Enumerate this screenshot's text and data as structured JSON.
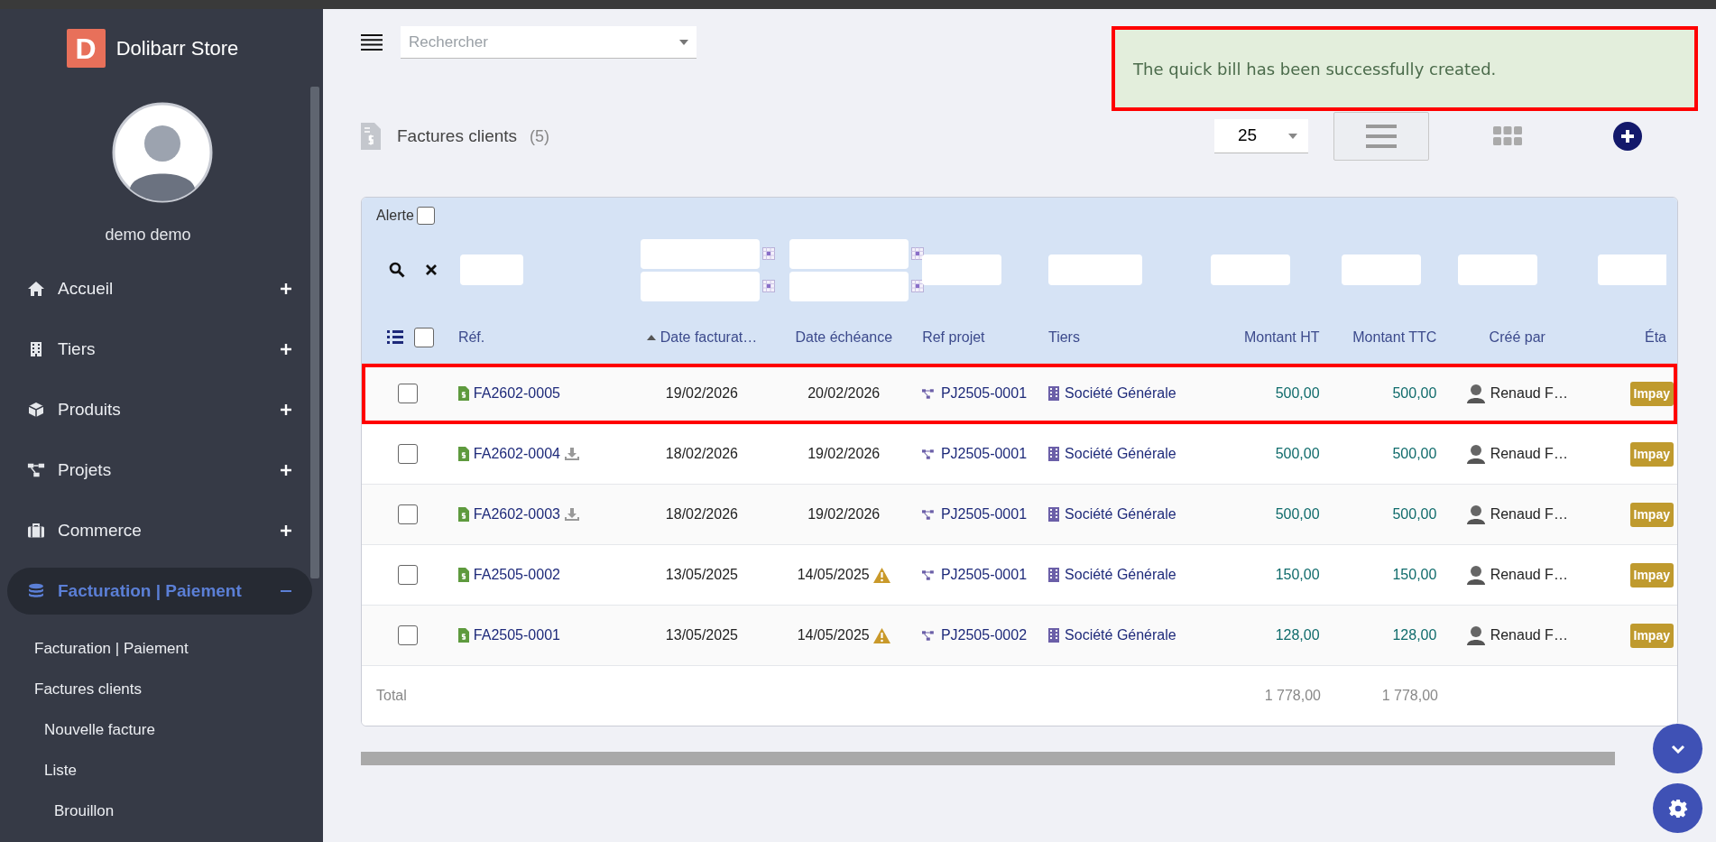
{
  "sidebar": {
    "brand": {
      "letter": "D",
      "name": "Dolibarr Store"
    },
    "user": {
      "name": "demo demo"
    },
    "menu": [
      {
        "label": "Accueil",
        "expanded": false,
        "selected": false
      },
      {
        "label": "Tiers",
        "expanded": false,
        "selected": false
      },
      {
        "label": "Produits",
        "expanded": false,
        "selected": false
      },
      {
        "label": "Projets",
        "expanded": false,
        "selected": false
      },
      {
        "label": "Commerce",
        "expanded": false,
        "selected": false
      },
      {
        "label": "Facturation | Paiement",
        "expanded": true,
        "selected": true,
        "children": [
          {
            "label": "Facturation | Paiement"
          },
          {
            "label": "Factures clients",
            "children": [
              {
                "label": "Nouvelle facture"
              },
              {
                "label": "Liste",
                "children": [
                  {
                    "label": "Brouillon"
                  }
                ]
              }
            ]
          }
        ]
      }
    ]
  },
  "topbar": {
    "search": {
      "placeholder": "Rechercher"
    }
  },
  "toast": {
    "message": "The quick bill has been successfully created.",
    "highlighted": true
  },
  "list": {
    "title": "Factures clients",
    "count": "(5)",
    "per_page": "25",
    "views": [
      {
        "kind": "list",
        "selected": true
      },
      {
        "kind": "kanban",
        "selected": false
      }
    ]
  },
  "table": {
    "alert": {
      "label": "Alerte",
      "checked": false
    },
    "select_all": {
      "checked": false
    },
    "columns": [
      {
        "label": "Réf.",
        "sorted": false
      },
      {
        "label": "Date facturat…",
        "sorted": true
      },
      {
        "label": "Date échéance",
        "sorted": false
      },
      {
        "label": "Ref projet",
        "sorted": false
      },
      {
        "label": "Tiers",
        "sorted": false
      },
      {
        "label": "Montant HT",
        "sorted": false
      },
      {
        "label": "Montant TTC",
        "sorted": false
      },
      {
        "label": "Créé par",
        "sorted": false
      },
      {
        "label": "Éta",
        "sorted": false
      }
    ],
    "rows": [
      {
        "selected": false,
        "highlighted": true,
        "ref": "FA2602-0005",
        "download": false,
        "date_invoice": "19/02/2026",
        "date_due": "20/02/2026",
        "overdue": false,
        "project": "PJ2505-0001",
        "thirdparty": "Société Générale",
        "amount_ht": "500,00",
        "amount_ttc": "500,00",
        "created_by": "Renaud F…",
        "status": "Impay"
      },
      {
        "selected": false,
        "highlighted": false,
        "ref": "FA2602-0004",
        "download": true,
        "date_invoice": "18/02/2026",
        "date_due": "19/02/2026",
        "overdue": false,
        "project": "PJ2505-0001",
        "thirdparty": "Société Générale",
        "amount_ht": "500,00",
        "amount_ttc": "500,00",
        "created_by": "Renaud F…",
        "status": "Impay"
      },
      {
        "selected": false,
        "highlighted": false,
        "ref": "FA2602-0003",
        "download": true,
        "date_invoice": "18/02/2026",
        "date_due": "19/02/2026",
        "overdue": false,
        "project": "PJ2505-0001",
        "thirdparty": "Société Générale",
        "amount_ht": "500,00",
        "amount_ttc": "500,00",
        "created_by": "Renaud F…",
        "status": "Impay"
      },
      {
        "selected": false,
        "highlighted": false,
        "ref": "FA2505-0002",
        "download": false,
        "date_invoice": "13/05/2025",
        "date_due": "14/05/2025",
        "overdue": true,
        "project": "PJ2505-0001",
        "thirdparty": "Société Générale",
        "amount_ht": "150,00",
        "amount_ttc": "150,00",
        "created_by": "Renaud F…",
        "status": "Impay"
      },
      {
        "selected": false,
        "highlighted": false,
        "ref": "FA2505-0001",
        "download": false,
        "date_invoice": "13/05/2025",
        "date_due": "14/05/2025",
        "overdue": true,
        "project": "PJ2505-0002",
        "thirdparty": "Société Générale",
        "amount_ht": "128,00",
        "amount_ttc": "128,00",
        "created_by": "Renaud F…",
        "status": "Impay"
      }
    ],
    "total": {
      "label": "Total",
      "amount_ht": "1 778,00",
      "amount_ttc": "1 778,00"
    }
  }
}
